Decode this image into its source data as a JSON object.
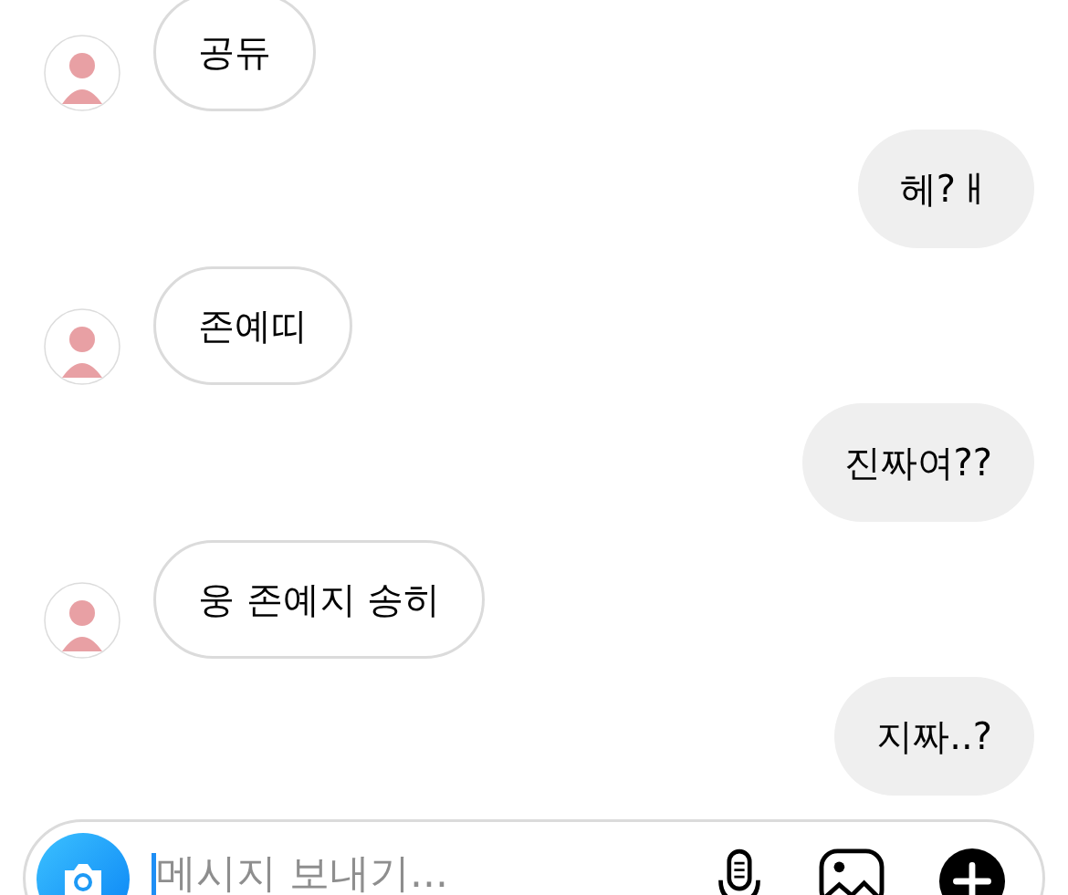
{
  "messages": [
    {
      "kind": "incoming",
      "text": "공듀"
    },
    {
      "kind": "outgoing",
      "text": "헤?ㅐ"
    },
    {
      "kind": "incoming",
      "text": "존예띠"
    },
    {
      "kind": "outgoing",
      "text": "진짜여??"
    },
    {
      "kind": "incoming",
      "text": "웅 존예지 송히"
    },
    {
      "kind": "outgoing",
      "text": "지짜..?"
    }
  ],
  "composer": {
    "placeholder": "메시지 보내기..."
  }
}
